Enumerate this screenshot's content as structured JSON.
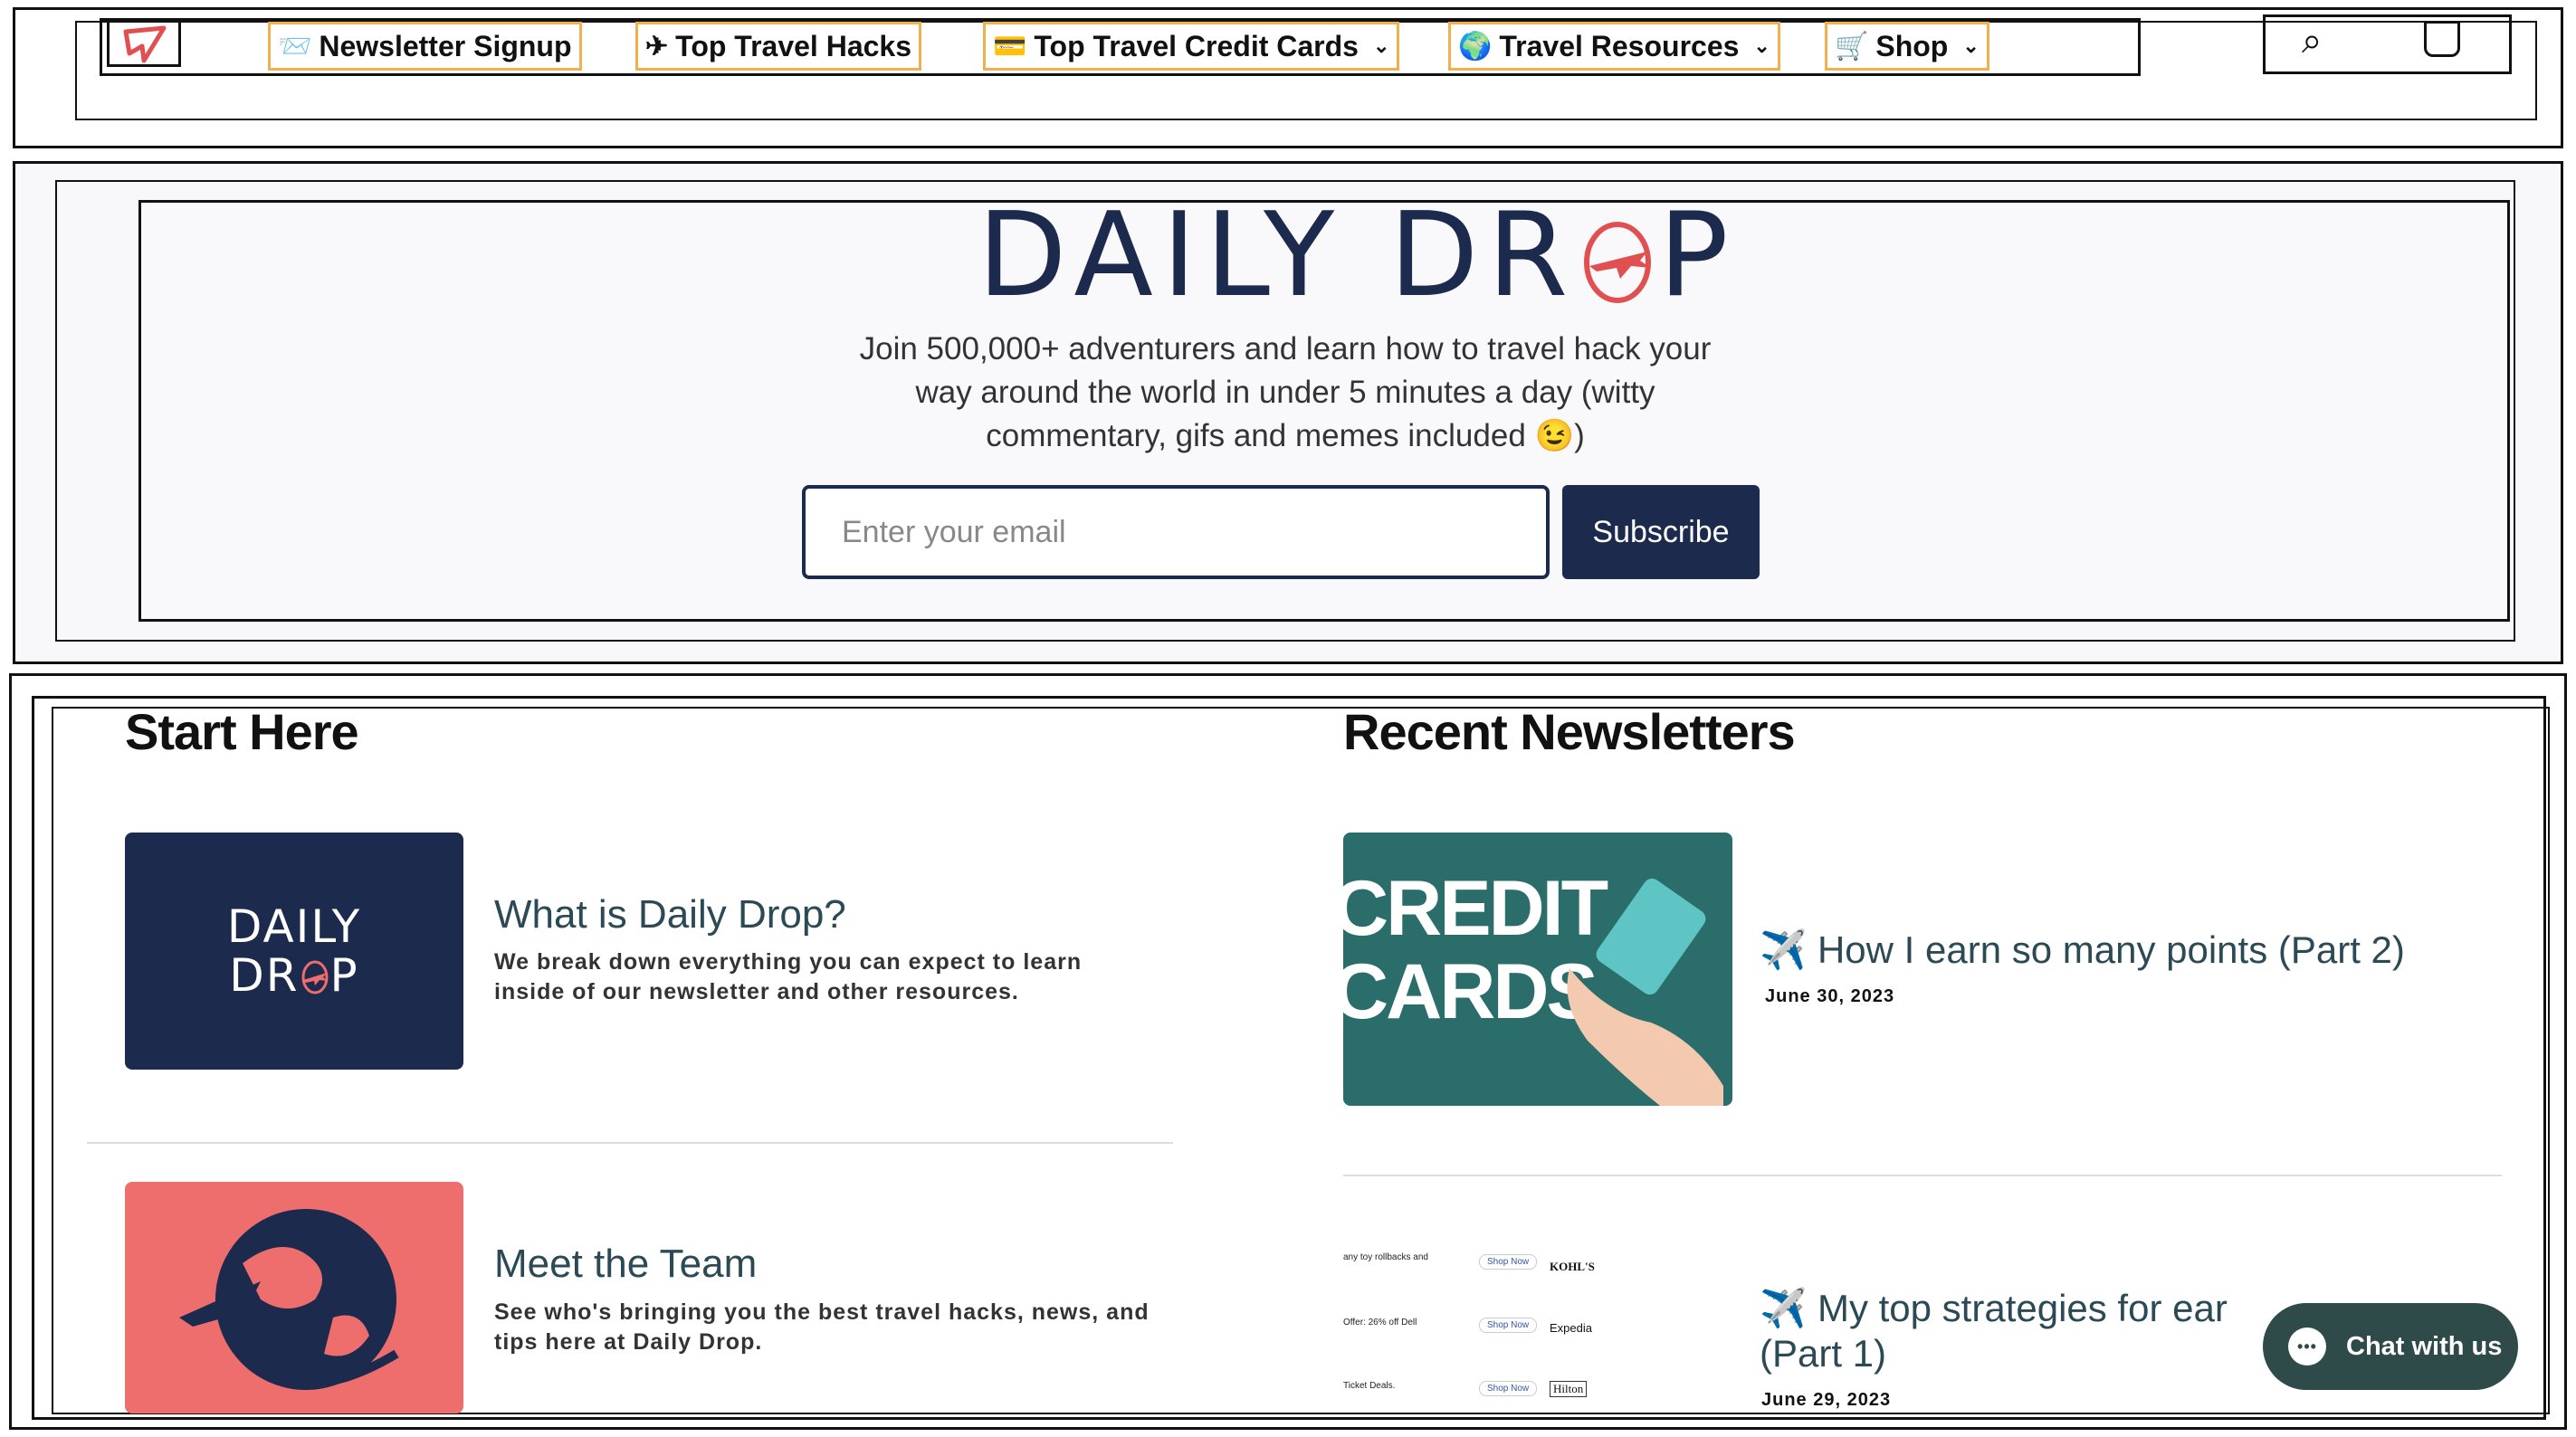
{
  "nav": {
    "items": [
      {
        "emoji": "📨",
        "label": "Newsletter Signup",
        "has_dropdown": false
      },
      {
        "emoji": "✈",
        "label": "Top Travel Hacks",
        "has_dropdown": false
      },
      {
        "emoji": "💳",
        "label": "Top Travel Credit Cards",
        "has_dropdown": true
      },
      {
        "emoji": "🌍",
        "label": "Travel Resources",
        "has_dropdown": true
      },
      {
        "emoji": "🛒",
        "label": "Shop",
        "has_dropdown": true
      }
    ],
    "chevron": "⌄",
    "search_icon": "⌕"
  },
  "hero": {
    "logo_left": "DAILY DR",
    "logo_right": "P",
    "tagline_line1": "Join 500,000+ adventurers and learn how to travel hack your",
    "tagline_line2": "way around the world in under 5 minutes a day (witty",
    "tagline_line3": "commentary, gifs and memes included 😉)",
    "email_placeholder": "Enter your email",
    "subscribe_label": "Subscribe"
  },
  "start_here": {
    "title": "Start Here",
    "cards": [
      {
        "thumb_line1": "DAILY",
        "thumb_line2": "DR",
        "thumb_line2_end": "P",
        "title": "What is Daily Drop?",
        "desc_line1": "We break down everything you can expect to learn",
        "desc_line2": "inside of our newsletter and other resources."
      },
      {
        "title": "Meet the Team",
        "desc_line1": "See who's bringing you the best travel hacks, news, and",
        "desc_line2": "tips here at Daily Drop."
      }
    ]
  },
  "recent": {
    "title": "Recent Newsletters",
    "posts": [
      {
        "thumb_line1": "CREDIT",
        "thumb_line2": "CARDS",
        "emoji": "✈️",
        "title": "How I earn so many points (Part 2)",
        "date": "June 30, 2023"
      },
      {
        "emoji": "✈️",
        "title_line1": "My top strategies for ear",
        "title_line2": "(Part 1)",
        "date": "June 29, 2023",
        "deals_line1": "any toy rollbacks and",
        "deals_line2": "Offer: 26% off Dell",
        "deals_line3": "Ticket Deals.",
        "deals_brand1": "KOHL'S",
        "deals_brand2": "Expedia",
        "deals_brand3": "Hilton",
        "deals_cta": "Shop Now"
      }
    ]
  },
  "chat": {
    "label": "Chat with us",
    "icon_dots": "•••"
  },
  "colors": {
    "navy": "#1c2a4d",
    "coral": "#ee6e6e",
    "teal": "#2a6d6b",
    "chat": "#2e4b49"
  }
}
